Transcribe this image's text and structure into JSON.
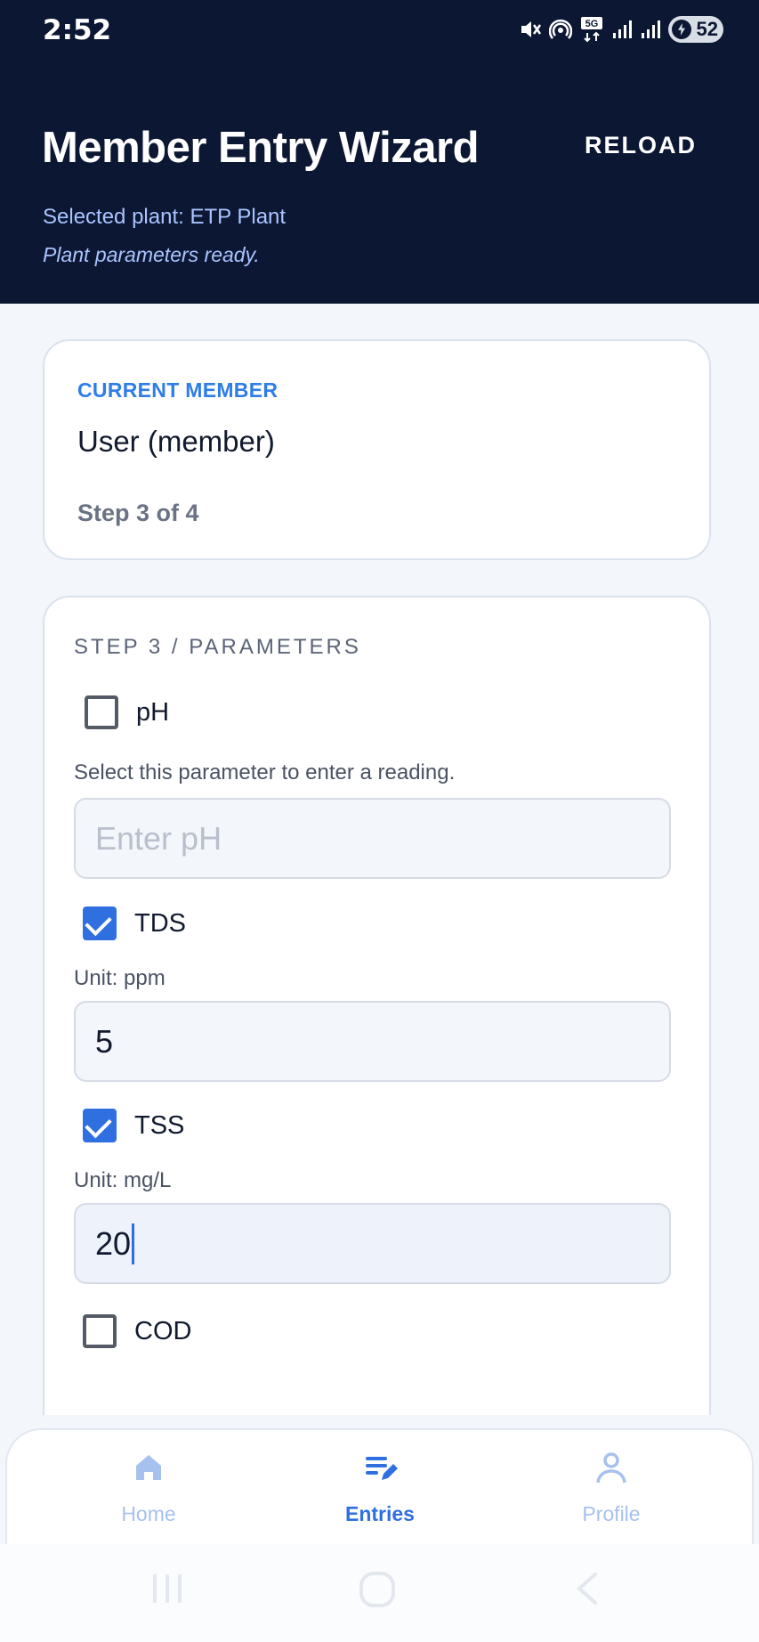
{
  "status_bar": {
    "time": "2:52",
    "battery": "52",
    "network": "5G"
  },
  "header": {
    "title": "Member Entry Wizard",
    "reload_label": "RELOAD",
    "plant_line": "Selected plant: ETP Plant",
    "plant_status": "Plant parameters ready."
  },
  "member_card": {
    "label": "CURRENT MEMBER",
    "name": "User (member)",
    "step": "Step 3 of 4"
  },
  "parameters": {
    "heading": "STEP 3 / PARAMETERS",
    "items": [
      {
        "label": "pH",
        "checked": false,
        "hint": "Select this parameter to enter a reading.",
        "placeholder": "Enter pH",
        "value": ""
      },
      {
        "label": "TDS",
        "checked": true,
        "hint": "Unit: ppm",
        "value": "5"
      },
      {
        "label": "TSS",
        "checked": true,
        "hint": "Unit: mg/L",
        "value": "20"
      },
      {
        "label": "COD",
        "checked": false
      }
    ]
  },
  "bottom_nav": {
    "items": [
      {
        "label": "Home",
        "icon": "home-icon",
        "active": false
      },
      {
        "label": "Entries",
        "icon": "entries-icon",
        "active": true
      },
      {
        "label": "Profile",
        "icon": "profile-icon",
        "active": false
      }
    ]
  },
  "colors": {
    "header_bg": "#0c1733",
    "accent": "#2f6fe0",
    "label_blue": "#2f7de6",
    "subtext_blue": "#a9c4ff"
  }
}
